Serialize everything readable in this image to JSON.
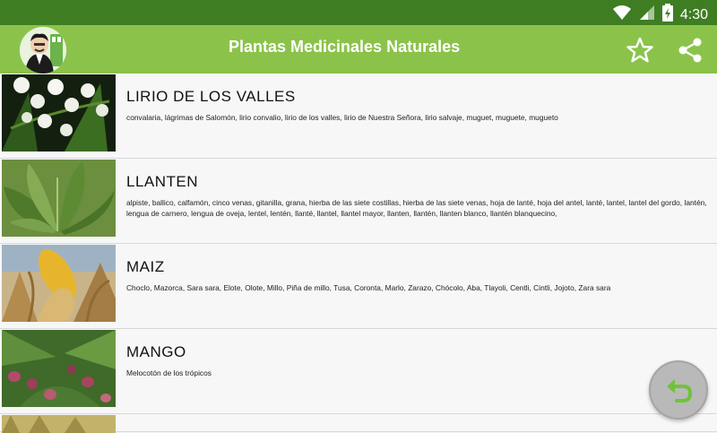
{
  "status": {
    "time": "4:30"
  },
  "app": {
    "title": "Plantas Medicinales Naturales"
  },
  "icons": {
    "wifi": "wifi-icon",
    "signal": "signal-icon",
    "battery": "battery-icon",
    "star": "star-icon",
    "share": "share-icon",
    "undo": "undo-icon"
  },
  "colors": {
    "statusbar": "#3f7d23",
    "appbar": "#8bc34a",
    "fab": "#b9b9b9",
    "fab_arrow": "#6fc33b"
  },
  "plants": [
    {
      "name": "LIRIO DE LOS VALLES",
      "synonyms": "convalaria,  lágrimas de Salomón,  lirio convalio,  lirio de los valles,  lirio de Nuestra Señora,  lirio salvaje,  muguet,  muguete,  mugueto"
    },
    {
      "name": "LLANTEN",
      "synonyms": "alpiste,  ballico,  calfamón,  cinco venas,  gitanilla,  grana,  hierba de las siete costillas,  hierba de las siete venas,  hoja de lanté,  hoja del antel,  lanté,  lantel,  lantel del gordo,  lantén,  lengua de carnero,  lengua de oveja,  lentel,  lentén,  llanté,  llantel,  llantel mayor,  llanten,  llantén,  llanten blanco,  llantén blanquecino,"
    },
    {
      "name": "MAIZ",
      "synonyms": "Choclo, Mazorca, Sara sara, Elote, Olote, Millo, Piña de millo, Tusa, Coronta, Marlo, Zarazo, Chócolo, Aba, Tlayoli, Centli, Cintli, Jojoto, Zara sara"
    },
    {
      "name": "MANGO",
      "synonyms": "Melocotón de los trópicos"
    }
  ]
}
